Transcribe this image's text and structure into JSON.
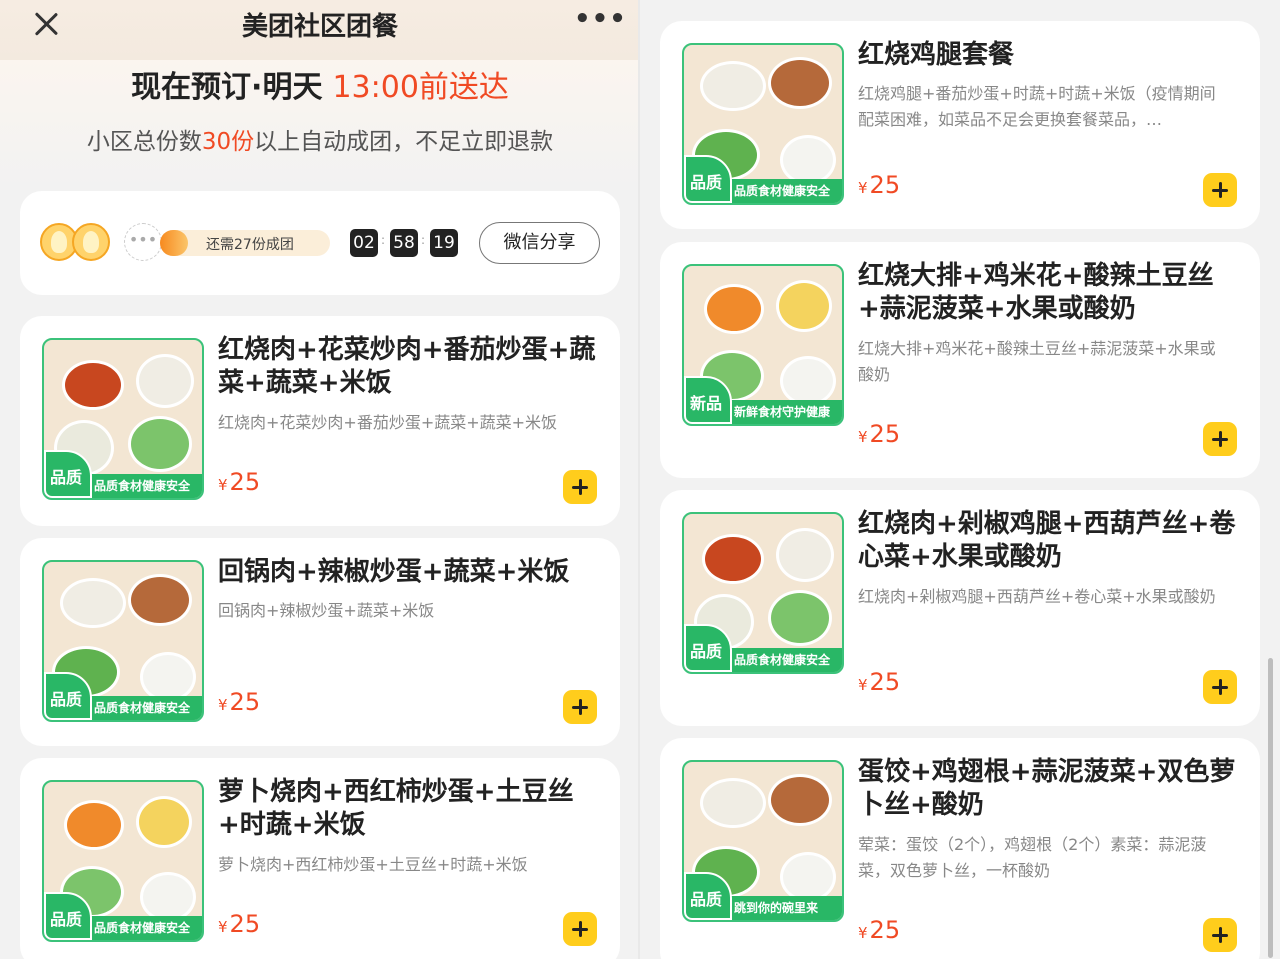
{
  "header": {
    "title": "美团社区团餐",
    "more_label": "•••"
  },
  "hero": {
    "order_prefix": "现在预订·明天",
    "order_time": "13:00前送达",
    "threshold_before": "小区总份数",
    "threshold_num": "30份",
    "threshold_after": "以上自动成团，不足立即退款"
  },
  "group": {
    "more_avatars": "•••",
    "progress_text": "还需27份成团",
    "progress_fraction": 0.1,
    "timer": {
      "h": "02",
      "m": "58",
      "s": "19"
    },
    "share_label": "微信分享"
  },
  "currency": "¥",
  "products_left": [
    {
      "title": "红烧肉+花菜炒肉+番茄炒蛋+蔬菜+蔬菜+米饭",
      "desc": "红烧肉+花菜炒肉+番茄炒蛋+蔬菜+蔬菜+米饭",
      "price": "25",
      "badge": "品质",
      "banner": "品质食材健康安全"
    },
    {
      "title": "回锅肉+辣椒炒蛋+蔬菜+米饭",
      "desc": "回锅肉+辣椒炒蛋+蔬菜+米饭",
      "price": "25",
      "badge": "品质",
      "banner": "品质食材健康安全"
    },
    {
      "title": "萝卜烧肉+西红柿炒蛋+土豆丝+时蔬+米饭",
      "desc": "萝卜烧肉+西红柿炒蛋+土豆丝+时蔬+米饭",
      "price": "25",
      "badge": "品质",
      "banner": "品质食材健康安全"
    }
  ],
  "products_right": [
    {
      "title": "红烧鸡腿套餐",
      "desc": "红烧鸡腿+番茄炒蛋+时蔬+时蔬+米饭（疫情期间配菜困难，如菜品不足会更换套餐菜品，…",
      "price": "25",
      "badge": "品质",
      "banner": "品质食材健康安全"
    },
    {
      "title": "红烧大排+鸡米花+酸辣土豆丝+蒜泥菠菜+水果或酸奶",
      "desc": "红烧大排+鸡米花+酸辣土豆丝+蒜泥菠菜+水果或酸奶",
      "price": "25",
      "badge": "新品",
      "banner": "新鲜食材守护健康"
    },
    {
      "title": "红烧肉+剁椒鸡腿+西葫芦丝+卷心菜+水果或酸奶",
      "desc": "红烧肉+剁椒鸡腿+西葫芦丝+卷心菜+水果或酸奶",
      "price": "25",
      "badge": "品质",
      "banner": "品质食材健康安全"
    },
    {
      "title": "蛋饺+鸡翅根+蒜泥菠菜+双色萝卜丝+酸奶",
      "desc": "荤菜：蛋饺（2个），鸡翅根（2个）素菜：蒜泥菠菜，双色萝卜丝，一杯酸奶",
      "price": "25",
      "badge": "品质",
      "banner": "跳到你的碗里来"
    }
  ]
}
